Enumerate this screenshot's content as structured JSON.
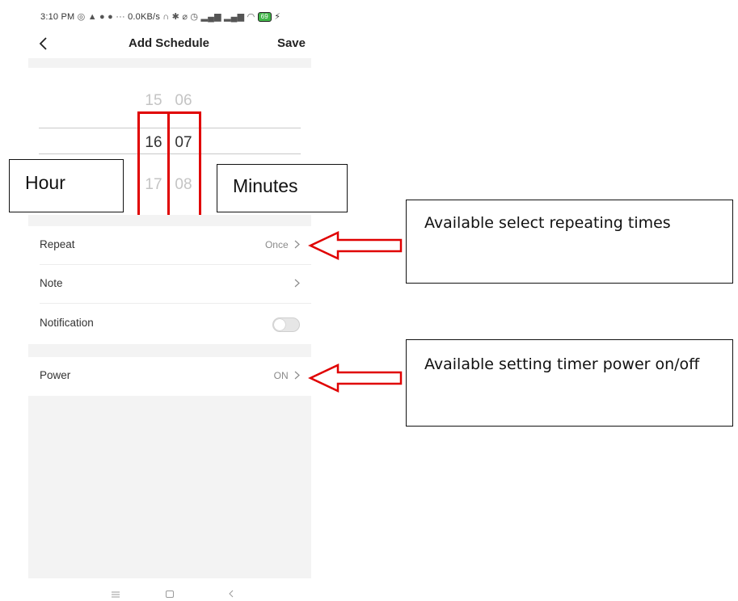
{
  "status_bar": {
    "time": "3:10 PM",
    "network_speed": "0.0KB/s",
    "battery": "69"
  },
  "header": {
    "title": "Add Schedule",
    "save_label": "Save"
  },
  "picker": {
    "hours": [
      "15",
      "16",
      "17"
    ],
    "minutes": [
      "06",
      "07",
      "08"
    ],
    "selected_hour": "16",
    "selected_minute": "07"
  },
  "annotations": {
    "hour_label": "Hour",
    "minutes_label": "Minutes",
    "repeat_callout": "Available select repeating times",
    "power_callout": "Available setting timer power on/off"
  },
  "settings": {
    "repeat": {
      "label": "Repeat",
      "value": "Once"
    },
    "note": {
      "label": "Note",
      "value": ""
    },
    "notification": {
      "label": "Notification",
      "enabled": false
    },
    "power": {
      "label": "Power",
      "value": "ON"
    }
  },
  "nav_bar": {
    "icons": [
      "menu-icon",
      "home-icon",
      "back-icon"
    ]
  },
  "colors": {
    "annotation_red": "#e00000",
    "background_gray": "#f3f3f3"
  }
}
